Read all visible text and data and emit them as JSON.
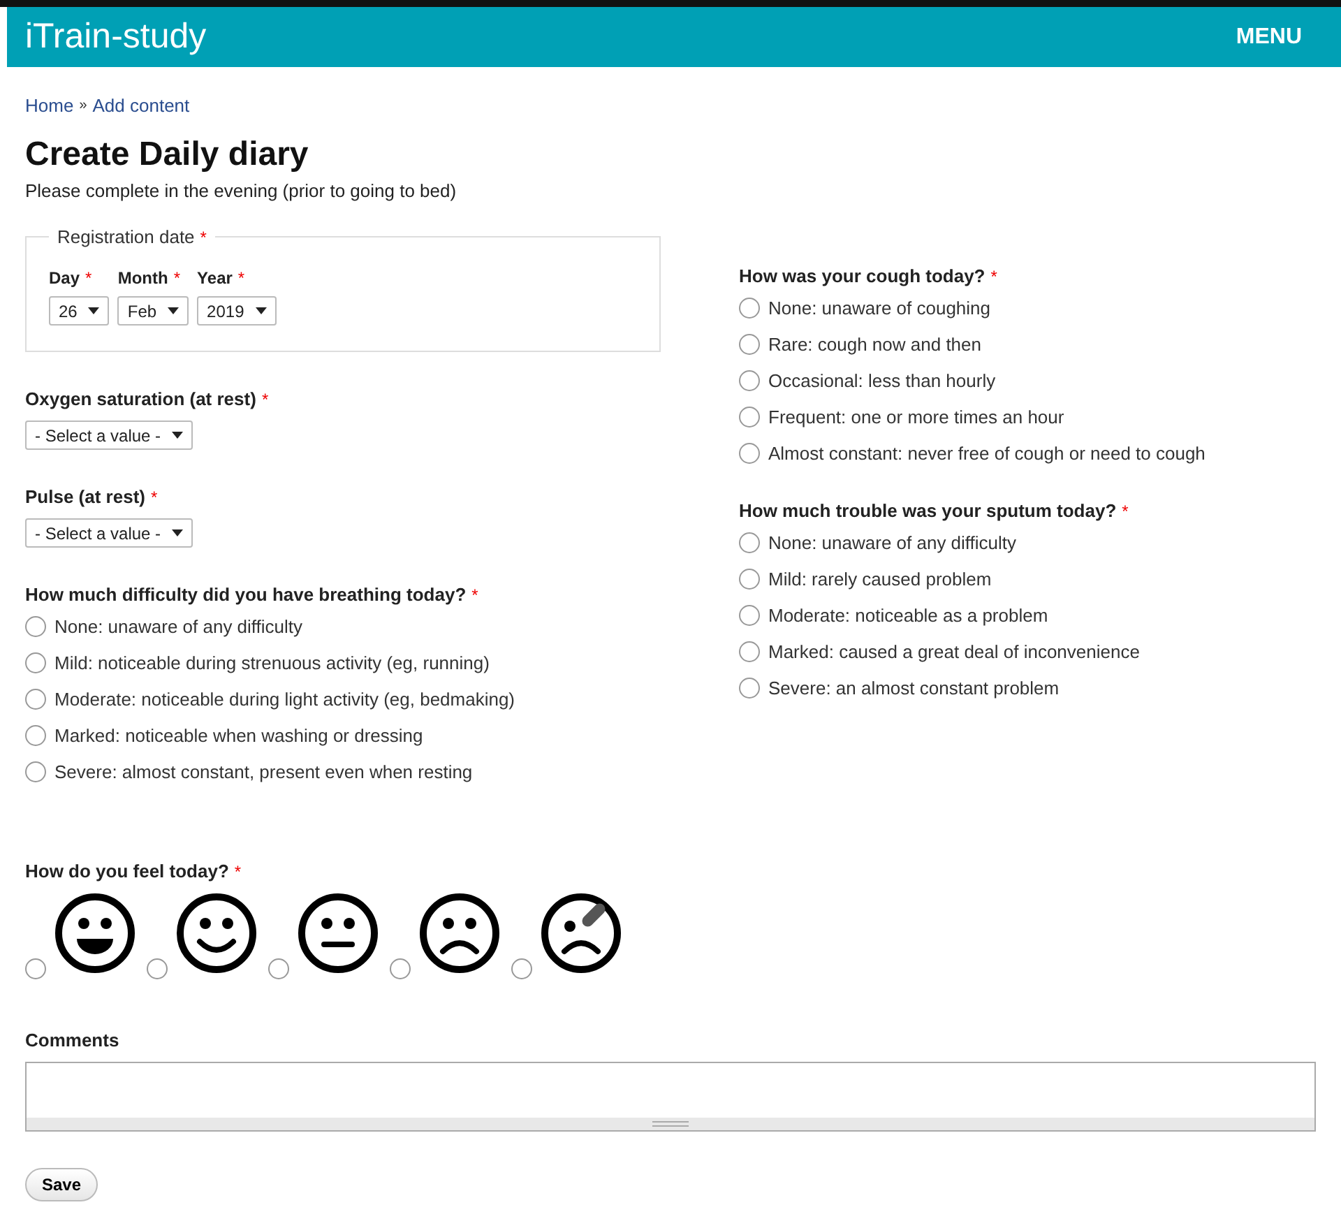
{
  "required_mark": "*",
  "header": {
    "site_name": "iTrain-study",
    "menu": "MENU"
  },
  "breadcrumb": [
    {
      "label": "Home"
    },
    {
      "label": "Add content"
    }
  ],
  "breadcrumb_separator": "»",
  "title": "Create Daily diary",
  "subtitle": "Please complete in the evening (prior to going to bed)",
  "registration_date": {
    "legend": "Registration date",
    "required": true,
    "parts": [
      {
        "label": "Day",
        "required": true,
        "value": "26"
      },
      {
        "label": "Month",
        "required": true,
        "value": "Feb"
      },
      {
        "label": "Year",
        "required": true,
        "value": "2019"
      }
    ]
  },
  "left_fields": [
    {
      "kind": "select",
      "label": "Oxygen saturation (at rest)",
      "required": true,
      "value": "- Select a value -"
    },
    {
      "kind": "select",
      "label": "Pulse (at rest)",
      "required": true,
      "value": "- Select a value -"
    },
    {
      "kind": "radios",
      "label": "How much difficulty did you have breathing today?",
      "required": true,
      "options": [
        {
          "label": "None: unaware of any difficulty",
          "selected": false
        },
        {
          "label": "Mild: noticeable during strenuous activity (eg, running)",
          "selected": false
        },
        {
          "label": "Moderate: noticeable during light activity (eg, bedmaking)",
          "selected": false
        },
        {
          "label": "Marked: noticeable when washing or dressing",
          "selected": false
        },
        {
          "label": "Severe: almost constant, present even when resting",
          "selected": false
        }
      ]
    }
  ],
  "right_fields": [
    {
      "kind": "radios",
      "label": "How was your cough today?",
      "required": true,
      "options": [
        {
          "label": "None: unaware of coughing",
          "selected": false
        },
        {
          "label": "Rare: cough now and then",
          "selected": false
        },
        {
          "label": "Occasional: less than hourly",
          "selected": false
        },
        {
          "label": "Frequent: one or more times an hour",
          "selected": false
        },
        {
          "label": "Almost constant: never free of cough or need to cough",
          "selected": false
        }
      ]
    },
    {
      "kind": "radios",
      "label": "How much trouble was your sputum today?",
      "required": true,
      "options": [
        {
          "label": "None: unaware of any difficulty",
          "selected": false
        },
        {
          "label": "Mild: rarely caused problem",
          "selected": false
        },
        {
          "label": "Moderate: noticeable as a problem",
          "selected": false
        },
        {
          "label": "Marked: caused a great deal of inconvenience",
          "selected": false
        },
        {
          "label": "Severe: an almost constant problem",
          "selected": false
        }
      ]
    }
  ],
  "feeling": {
    "label": "How do you feel today?",
    "required": true,
    "options": [
      {
        "kind": "grin",
        "selected": false
      },
      {
        "kind": "smile",
        "selected": false
      },
      {
        "kind": "neutral",
        "selected": false
      },
      {
        "kind": "frown",
        "selected": false
      },
      {
        "kind": "hurt",
        "selected": false
      }
    ]
  },
  "comments": {
    "label": "Comments"
  },
  "save_button": "Save"
}
